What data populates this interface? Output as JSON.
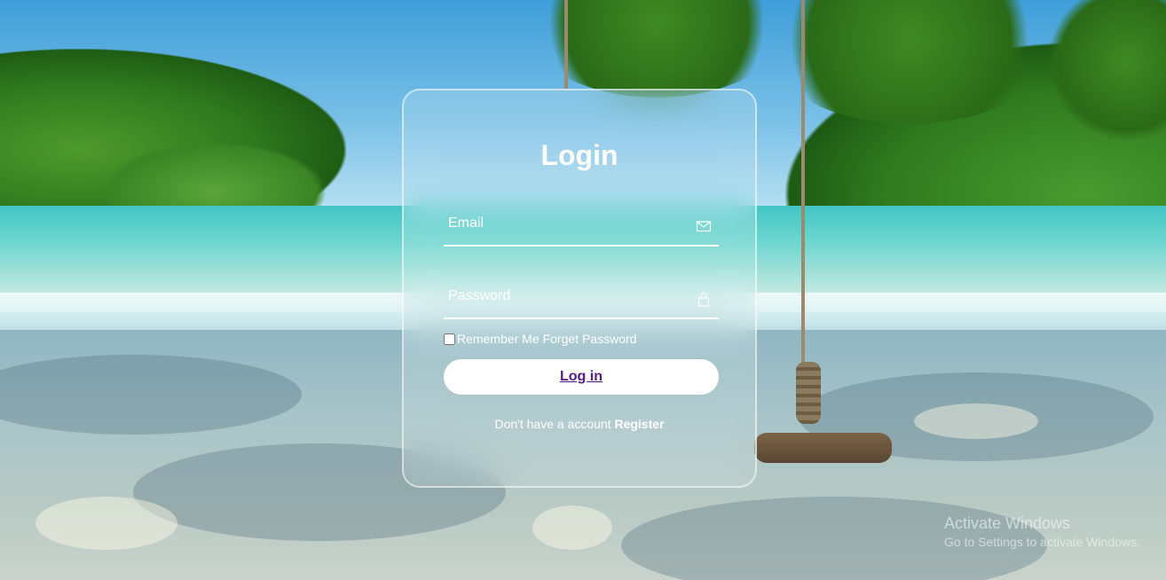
{
  "login": {
    "title": "Login",
    "email_placeholder": "Email",
    "password_placeholder": "Password",
    "remember_label": "Remember Me",
    "forgot_label": "Forget Password",
    "login_button": "Log in",
    "no_account_text": "Don't have a account",
    "register_link": "Register"
  },
  "icons": {
    "email": "envelope-icon",
    "password": "lock-icon"
  },
  "watermark": {
    "line1": "Activate Windows",
    "line2": "Go to Settings to activate Windows."
  },
  "colors": {
    "button_text": "#5a1a8c",
    "card_border": "#ffffff"
  }
}
